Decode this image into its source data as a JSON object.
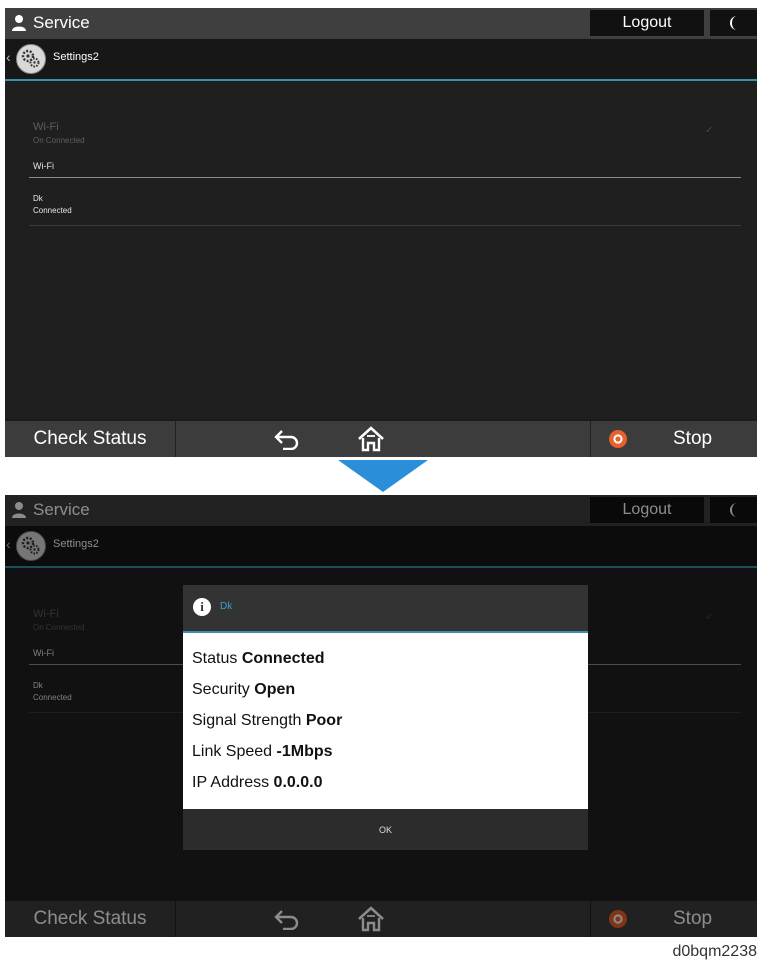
{
  "screens": [
    {
      "header": {
        "title": "Service",
        "logout_label": "Logout"
      },
      "subheader": {
        "back": "‹",
        "title": "Settings2"
      },
      "content": {
        "wifi_label": "Wi-Fi",
        "wifi_state": "On Connected",
        "check": "✓",
        "wifi_item": "Wi-Fi",
        "ssid": "Dk",
        "ssid_status": "Connected"
      },
      "bottom": {
        "check_status": "Check Status",
        "stop": "Stop"
      }
    },
    {
      "header": {
        "title": "Service",
        "logout_label": "Logout"
      },
      "subheader": {
        "back": "‹",
        "title": "Settings2"
      },
      "content": {
        "wifi_label": "Wi-Fi",
        "wifi_state": "On Connected",
        "check": "✓",
        "wifi_item": "Wi-Fi",
        "ssid": "Dk",
        "ssid_status": "Connected"
      },
      "dialog": {
        "title": "Dk",
        "info_glyph": "i",
        "rows": [
          {
            "label": "Status",
            "value": "Connected"
          },
          {
            "label": "Security",
            "value": "Open"
          },
          {
            "label": "Signal Strength",
            "value": "Poor"
          },
          {
            "label": "Link Speed",
            "value": "-1Mbps"
          },
          {
            "label": "IP Address",
            "value": "0.0.0.0"
          }
        ],
        "ok_label": "OK"
      },
      "bottom": {
        "check_status": "Check Status",
        "stop": "Stop"
      }
    }
  ],
  "figure_code": "d0bqm2238",
  "colors": {
    "accent": "#3a8fb0",
    "stop": "#e8612c",
    "arrow": "#2a8fd8"
  },
  "icons": [
    "user-icon",
    "moon-icon",
    "gear-icon",
    "back-arrow-icon",
    "home-icon",
    "stop-icon",
    "info-icon",
    "down-arrow-icon"
  ]
}
